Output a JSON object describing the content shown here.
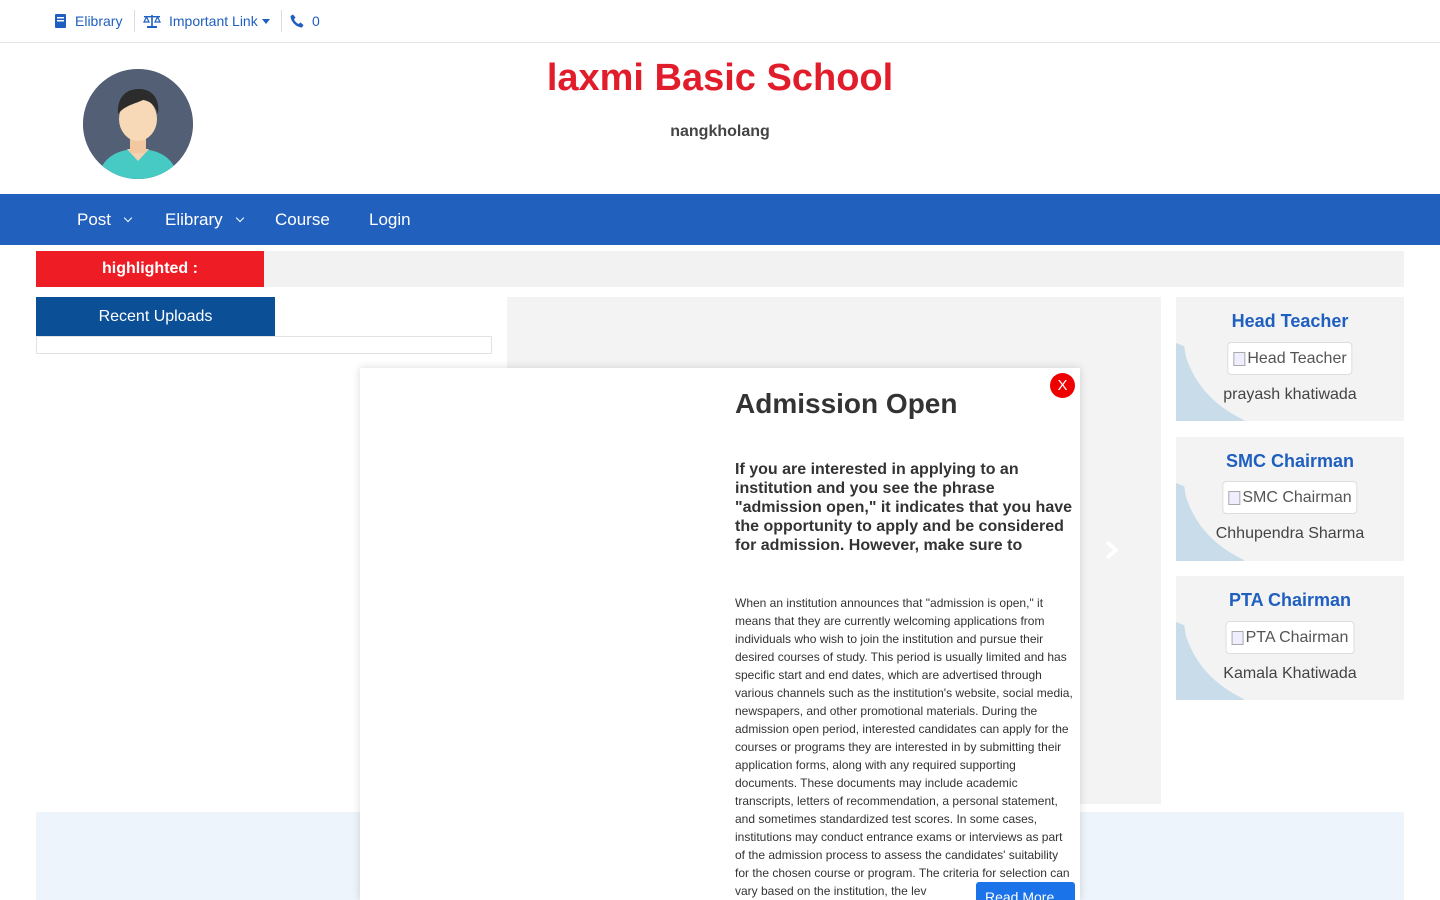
{
  "topbar": {
    "elibrary": "Elibrary",
    "important_link": "Important Link",
    "phone": "0"
  },
  "header": {
    "title": "laxmi Basic School",
    "subtitle": "nangkholang"
  },
  "nav": {
    "items": [
      {
        "label": "Post"
      },
      {
        "label": "Elibrary"
      },
      {
        "label": "Course"
      },
      {
        "label": "Login"
      }
    ]
  },
  "highlight": {
    "label": "highlighted :"
  },
  "recent_uploads": {
    "title": "Recent Uploads"
  },
  "cards": [
    {
      "title": "Head Teacher",
      "img_alt": "Head Teacher",
      "name": "prayash khatiwada"
    },
    {
      "title": "SMC Chairman",
      "img_alt": "SMC Chairman",
      "name": "Chhupendra Sharma"
    },
    {
      "title": "PTA Chairman",
      "img_alt": "PTA Chairman",
      "name": "Kamala Khatiwada"
    }
  ],
  "modal": {
    "close": "X",
    "title": "Admission Open",
    "lead": "If you are interested in applying to an institution and you see the phrase \"admission open,\" it indicates that you have the opportunity to apply and be considered for admission. However, make sure to",
    "body": "When an institution announces that \"admission is open,\" it means that they are currently welcoming applications from individuals who wish to join the institution and pursue their desired courses of study. This period is usually limited and has specific start and end dates, which are advertised through various channels such as the institution's website, social media, newspapers, and other promotional materials. During the admission open period, interested candidates can apply for the courses or programs they are interested in by submitting their application forms, along with any required supporting documents. These documents may include academic transcripts, letters of recommendation, a personal statement, and sometimes standardized test scores. In some cases, institutions may conduct entrance exams or interviews as part of the admission process to assess the candidates' suitability for the chosen course or program. The criteria for selection can vary based on the institution, the lev",
    "read_more": "Read More"
  },
  "colors": {
    "primary_blue": "#2260be",
    "title_red": "#e21d2b",
    "highlight_red": "#ee1c25",
    "dark_blue": "#0b4f97"
  }
}
